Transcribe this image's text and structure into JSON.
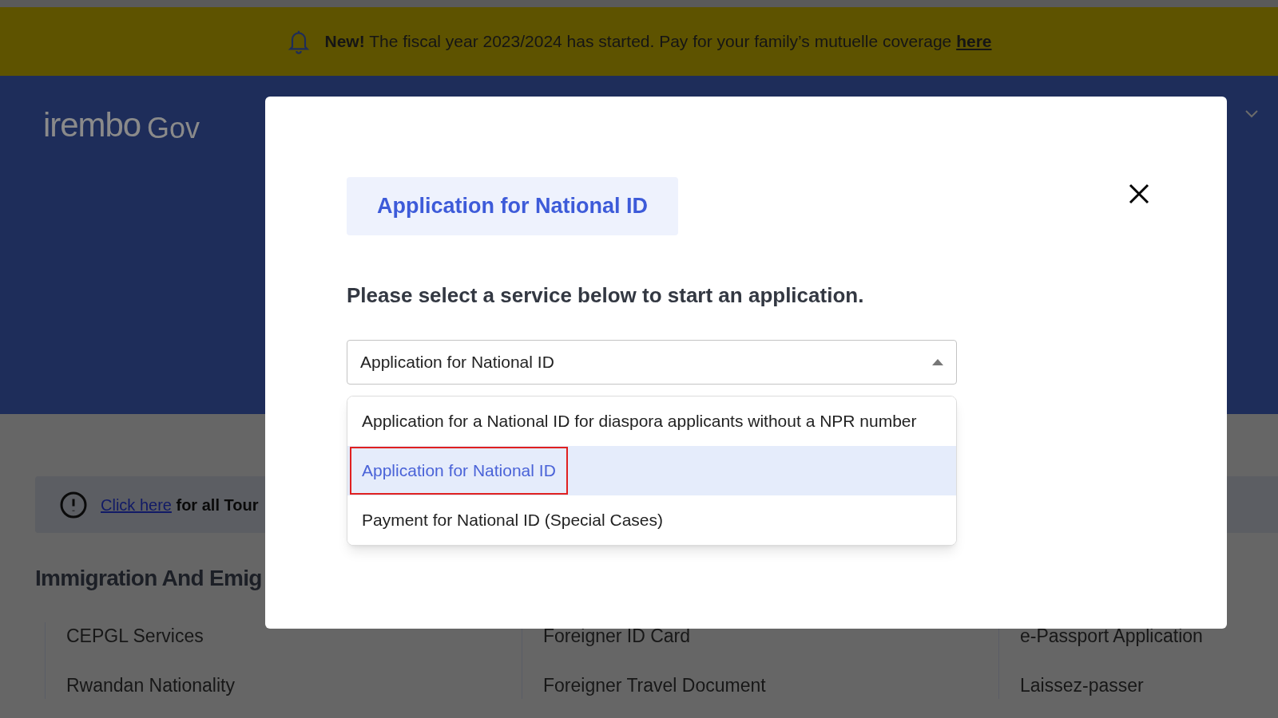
{
  "banner": {
    "text": "**New!** The fiscal year 2023/2024 has started. Pay for your family’s mutuelle coverage",
    "link": "here"
  },
  "header": {
    "logo": "irembo",
    "logo_suffix": "Gov"
  },
  "notice": {
    "link": "Click here",
    "text": "for all Tour"
  },
  "section": {
    "title": "Immigration And Emig"
  },
  "service_columns": [
    [
      "CEPGL Services",
      "Rwandan Nationality"
    ],
    [
      "Foreigner ID Card",
      "Foreigner Travel Document"
    ],
    [
      "e-Passport Application",
      "Laissez-passer"
    ]
  ],
  "modal": {
    "title": "Application for National ID",
    "prompt": "Please select a service below to start an application.",
    "select": {
      "value": "Application for National ID",
      "expanded": true
    },
    "options": [
      {
        "label": "Application for a National ID for diaspora applicants without a NPR number",
        "selected": false,
        "outlined": false
      },
      {
        "label": "Application for National ID",
        "selected": true,
        "outlined": true
      },
      {
        "label": "Payment for National ID (Special Cases)",
        "selected": false,
        "outlined": false
      }
    ]
  }
}
